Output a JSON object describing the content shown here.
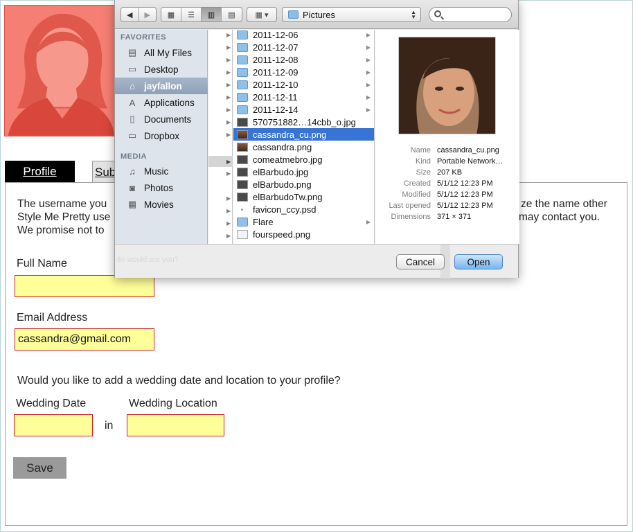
{
  "tabs": [
    {
      "label": "Profile"
    },
    {
      "label": "Sub"
    }
  ],
  "intro": {
    "line1_left": "The username you",
    "line1_right": "ze the name other",
    "line2_left": "Style Me Pretty use",
    "line2_right": "may contact you.",
    "line3_left": "We promise not to"
  },
  "form": {
    "full_name_label": "Full Name",
    "full_name_value": "",
    "email_label": "Email Address",
    "email_value": "cassandra@gmail.com",
    "wedding_question": "Would you like to add a wedding date and location to your profile?",
    "wedding_date_label": "Wedding Date",
    "wedding_date_value": "",
    "in_label": "in",
    "wedding_location_label": "Wedding Location",
    "wedding_location_value": "",
    "save_label": "Save"
  },
  "dialog": {
    "location": "Pictures",
    "search_placeholder": "",
    "sidebar": {
      "favorites_heading": "FAVORITES",
      "favorites": [
        {
          "label": "All My Files",
          "icon": "all-files-icon"
        },
        {
          "label": "Desktop",
          "icon": "desktop-icon"
        },
        {
          "label": "jayfallon",
          "icon": "home-icon",
          "selected": true
        },
        {
          "label": "Applications",
          "icon": "applications-icon"
        },
        {
          "label": "Documents",
          "icon": "documents-icon"
        },
        {
          "label": "Dropbox",
          "icon": "folder-icon"
        }
      ],
      "media_heading": "MEDIA",
      "media": [
        {
          "label": "Music",
          "icon": "music-icon"
        },
        {
          "label": "Photos",
          "icon": "camera-icon"
        },
        {
          "label": "Movies",
          "icon": "film-icon"
        }
      ]
    },
    "files": [
      {
        "name": "2011-12-06",
        "kind": "folder",
        "arrow": true
      },
      {
        "name": "2011-12-07",
        "kind": "folder",
        "arrow": true
      },
      {
        "name": "2011-12-08",
        "kind": "folder",
        "arrow": true
      },
      {
        "name": "2011-12-09",
        "kind": "folder",
        "arrow": true
      },
      {
        "name": "2011-12-10",
        "kind": "folder",
        "arrow": true
      },
      {
        "name": "2011-12-11",
        "kind": "folder",
        "arrow": true
      },
      {
        "name": "2011-12-14",
        "kind": "folder",
        "arrow": true
      },
      {
        "name": "570751882…14cbb_o.jpg",
        "kind": "img"
      },
      {
        "name": "cassandra_cu.png",
        "kind": "photo",
        "selected": true
      },
      {
        "name": "cassandra.png",
        "kind": "photo"
      },
      {
        "name": "comeatmebro.jpg",
        "kind": "img"
      },
      {
        "name": "elBarbudo.jpg",
        "kind": "img"
      },
      {
        "name": "elBarbudo.png",
        "kind": "img"
      },
      {
        "name": "elBarbudoTw.png",
        "kind": "img"
      },
      {
        "name": "favicon_ccy.psd",
        "kind": "dot"
      },
      {
        "name": "Flare",
        "kind": "folder",
        "arrow": true
      },
      {
        "name": "fourspeed.png",
        "kind": "doc"
      }
    ],
    "meta": [
      {
        "key": "Name",
        "value": "cassandra_cu.png"
      },
      {
        "key": "Kind",
        "value": "Portable Network…"
      },
      {
        "key": "Size",
        "value": "207 KB"
      },
      {
        "key": "Created",
        "value": "5/1/12 12:23 PM"
      },
      {
        "key": "Modified",
        "value": "5/1/12 12:23 PM"
      },
      {
        "key": "Last opened",
        "value": "5/1/12 12:23 PM"
      },
      {
        "key": "Dimensions",
        "value": "371 × 371"
      }
    ],
    "ghost_text": "do would are you?",
    "cancel_label": "Cancel",
    "open_label": "Open"
  }
}
